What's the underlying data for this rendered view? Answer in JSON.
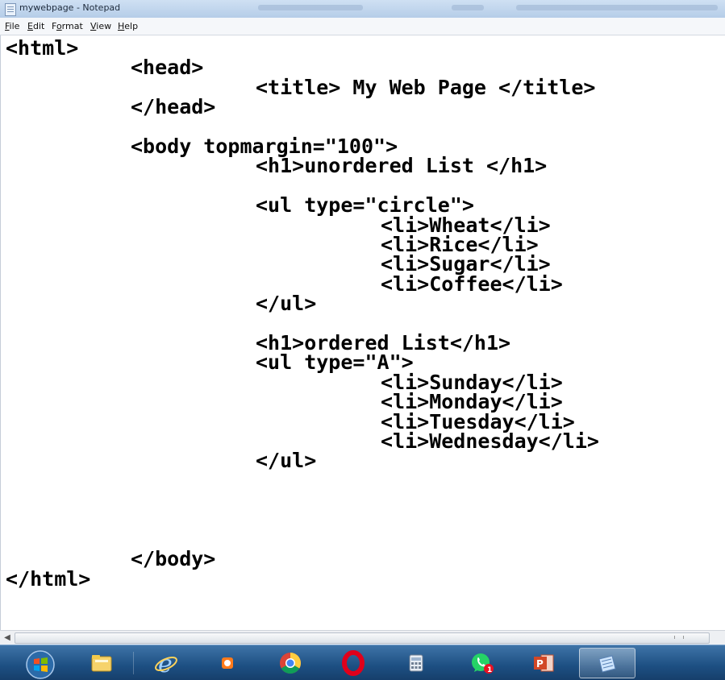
{
  "window": {
    "title": "mywebpage - Notepad"
  },
  "menu": [
    {
      "label": "File",
      "accel": "F"
    },
    {
      "label": "Edit",
      "accel": "E"
    },
    {
      "label": "Format",
      "accel": "o"
    },
    {
      "label": "View",
      "accel": "V"
    },
    {
      "label": "Help",
      "accel": "H"
    }
  ],
  "editor": {
    "lines": [
      "<html>",
      "\t<head>",
      "\t\t<title> My Web Page </title>",
      "\t</head>",
      "",
      "\t<body topmargin=\"100\">",
      "\t\t<h1>unordered List </h1>",
      "",
      "\t\t<ul type=\"circle\">",
      "\t\t\t<li>Wheat</li>",
      "\t\t\t<li>Rice</li>",
      "\t\t\t<li>Sugar</li>",
      "\t\t\t<li>Coffee</li>",
      "\t\t</ul>",
      "",
      "\t\t<h1>ordered List</h1>",
      "\t\t<ul type=\"A\">",
      "\t\t\t<li>Sunday</li>",
      "\t\t\t<li>Monday</li>",
      "\t\t\t<li>Tuesday</li>",
      "\t\t\t<li>Wednesday</li>",
      "\t\t</ul>",
      "",
      "",
      "",
      "",
      "\t</body>",
      "</html>"
    ]
  },
  "taskbar": {
    "items": [
      {
        "name": "start-button",
        "icon": "windows-start-icon"
      },
      {
        "name": "file-explorer",
        "icon": "folder-icon"
      },
      {
        "name": "internet-explorer",
        "icon": "internet-explorer-icon"
      },
      {
        "name": "media-player",
        "icon": "media-player-icon"
      },
      {
        "name": "chrome",
        "icon": "chrome-icon"
      },
      {
        "name": "opera",
        "icon": "opera-icon"
      },
      {
        "name": "calculator",
        "icon": "calculator-icon"
      },
      {
        "name": "whatsapp",
        "icon": "whatsapp-icon"
      },
      {
        "name": "powerpoint",
        "icon": "powerpoint-icon"
      },
      {
        "name": "notepad",
        "icon": "notepad-icon",
        "active": true
      }
    ]
  }
}
